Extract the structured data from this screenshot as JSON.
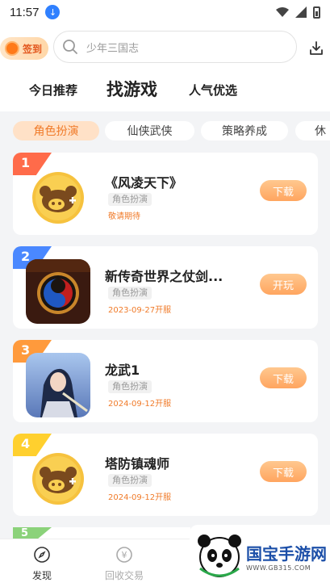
{
  "status_bar": {
    "time": "11:57",
    "download_badge": "↓"
  },
  "header": {
    "signin_label": "签到",
    "search_placeholder": "少年三国志",
    "tabs": [
      {
        "label": "今日推荐",
        "active": false
      },
      {
        "label": "找游戏",
        "active": true
      },
      {
        "label": "人气优选",
        "active": false
      }
    ]
  },
  "categories": [
    {
      "label": "角色扮演",
      "active": true
    },
    {
      "label": "仙侠武侠",
      "active": false
    },
    {
      "label": "策略养成",
      "active": false
    },
    {
      "label": "休",
      "active": false
    }
  ],
  "games": [
    {
      "rank": "1",
      "name": "《风凌天下》",
      "tag": "角色扮演",
      "date": "敬请期待",
      "action": "下载",
      "rank_color": "#ff6b4a",
      "icon": "default-app-icon"
    },
    {
      "rank": "2",
      "name": "新传奇世界之仗剑...",
      "tag": "角色扮演",
      "date": "2023-09-27开服",
      "action": "开玩",
      "rank_color": "#4a88ff",
      "icon": "legend-world-icon"
    },
    {
      "rank": "3",
      "name": "龙武1",
      "tag": "角色扮演",
      "date": "2024-09-12开服",
      "action": "下载",
      "rank_color": "#ff9a3c",
      "icon": "longwu-icon"
    },
    {
      "rank": "4",
      "name": "塔防镇魂师",
      "tag": "角色扮演",
      "date": "2024-09-12开服",
      "action": "下载",
      "rank_color": "#ffd02e",
      "icon": "default-app-icon"
    },
    {
      "rank": "5",
      "rank_color": "#8bd27a"
    }
  ],
  "bottom_nav": [
    {
      "label": "发现",
      "icon": "discover-icon",
      "active": true
    },
    {
      "label": "回收交易",
      "icon": "recycle-trade-icon",
      "active": false
    }
  ],
  "watermark": {
    "main": "国宝手游网",
    "sub": "WWW.GB315.COM"
  },
  "colors": {
    "accent": "#f07b2a",
    "button_gradient": [
      "#ffc88f",
      "#ffa55f"
    ]
  }
}
